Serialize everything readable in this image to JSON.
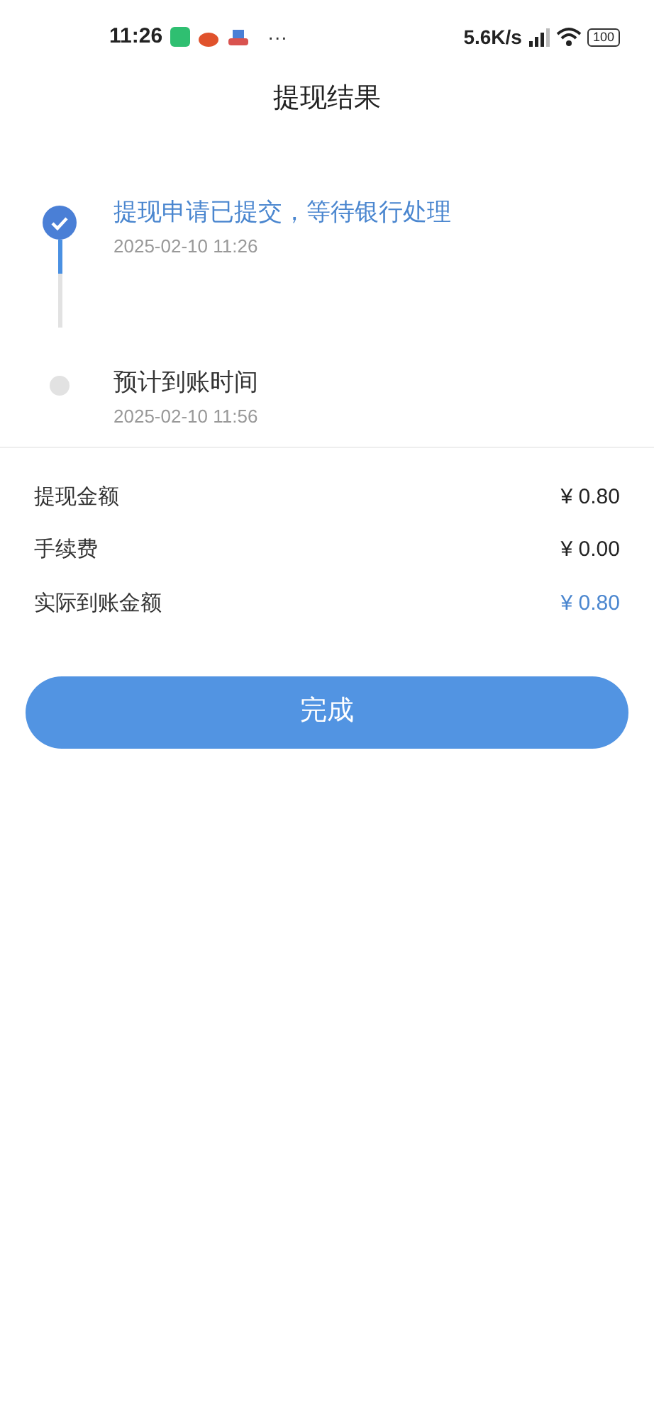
{
  "status_bar": {
    "time": "11:26",
    "more": "···",
    "speed": "5.6K/s",
    "battery": "100"
  },
  "title": "提现结果",
  "steps": [
    {
      "title": "提现申请已提交，等待银行处理",
      "time": "2025-02-10 11:26",
      "done": true
    },
    {
      "title": "预计到账时间",
      "time": "2025-02-10 11:56",
      "done": false
    }
  ],
  "amounts": [
    {
      "label": "提现金额",
      "value": "¥ 0.80",
      "highlight": false
    },
    {
      "label": "手续费",
      "value": "¥ 0.00",
      "highlight": false
    },
    {
      "label": "实际到账金额",
      "value": "¥ 0.80",
      "highlight": true
    }
  ],
  "button": "完成"
}
